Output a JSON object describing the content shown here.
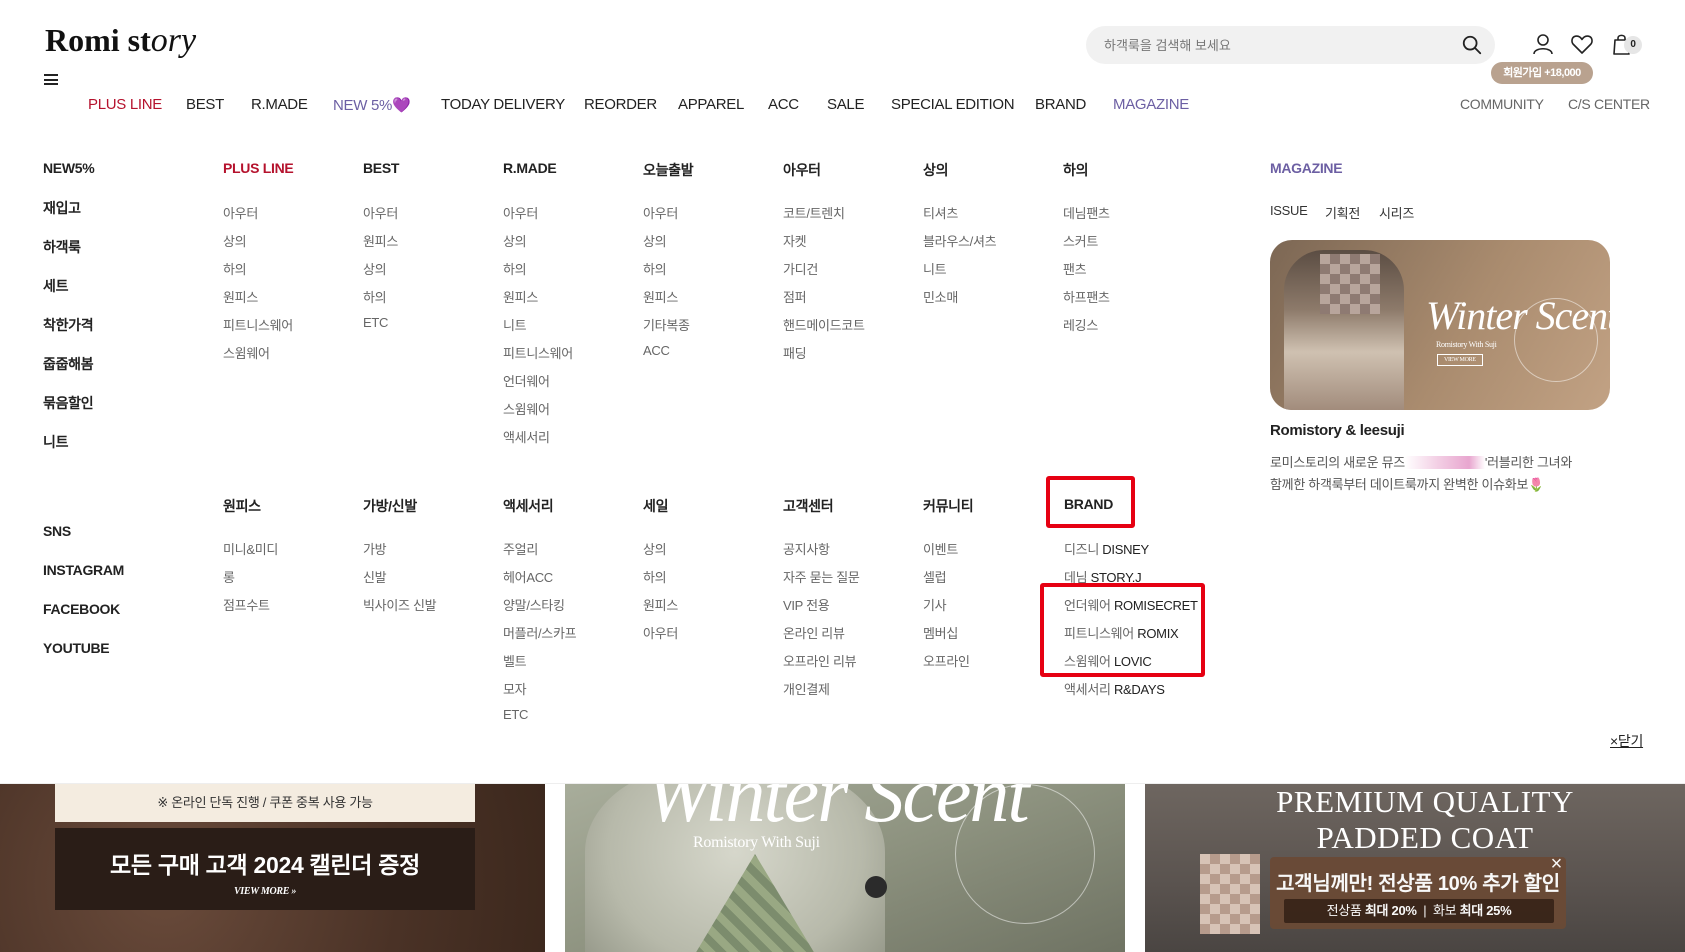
{
  "header": {
    "logo_main": "Romi st",
    "logo_script": "ory",
    "search_placeholder": "하객룩을 검색해 보세요",
    "cart_count": "0",
    "join_badge": "회원가입 +18,000"
  },
  "nav": {
    "items": [
      "PLUS LINE",
      "BEST",
      "R.MADE",
      "NEW 5%💜",
      "TODAY DELIVERY",
      "REORDER",
      "APPAREL",
      "ACC",
      "SALE",
      "SPECIAL EDITION",
      "BRAND",
      "MAGAZINE"
    ],
    "right": [
      "COMMUNITY",
      "C/S CENTER"
    ]
  },
  "left_menu": {
    "top": [
      "NEW5%",
      "재입고",
      "하객룩",
      "세트",
      "착한가격",
      "줍줍해봄",
      "묶음할인",
      "니트"
    ],
    "social": [
      "SNS",
      "INSTAGRAM",
      "FACEBOOK",
      "YOUTUBE"
    ]
  },
  "columns_row1": [
    {
      "head": "PLUS LINE",
      "items": [
        "아우터",
        "상의",
        "하의",
        "원피스",
        "피트니스웨어",
        "스윔웨어"
      ]
    },
    {
      "head": "BEST",
      "items": [
        "아우터",
        "원피스",
        "상의",
        "하의",
        "ETC"
      ]
    },
    {
      "head": "R.MADE",
      "items": [
        "아우터",
        "상의",
        "하의",
        "원피스",
        "니트",
        "피트니스웨어",
        "언더웨어",
        "스윔웨어",
        "액세서리"
      ]
    },
    {
      "head": "오늘출발",
      "items": [
        "아우터",
        "상의",
        "하의",
        "원피스",
        "기타복종",
        "ACC"
      ]
    },
    {
      "head": "아우터",
      "items": [
        "코트/트렌치",
        "자켓",
        "가디건",
        "점퍼",
        "핸드메이드코트",
        "패딩"
      ]
    },
    {
      "head": "상의",
      "items": [
        "티셔츠",
        "블라우스/셔츠",
        "니트",
        "민소매"
      ]
    },
    {
      "head": "하의",
      "items": [
        "데님팬츠",
        "스커트",
        "팬츠",
        "하프팬츠",
        "레깅스"
      ]
    }
  ],
  "columns_row2": [
    {
      "head": "원피스",
      "items": [
        "미니&미디",
        "롱",
        "점프수트"
      ]
    },
    {
      "head": "가방/신발",
      "items": [
        "가방",
        "신발",
        "빅사이즈 신발"
      ]
    },
    {
      "head": "액세서리",
      "items": [
        "주얼리",
        "헤어ACC",
        "양말/스타킹",
        "머플러/스카프",
        "벨트",
        "모자",
        "ETC"
      ]
    },
    {
      "head": "세일",
      "items": [
        "상의",
        "하의",
        "원피스",
        "아우터"
      ]
    },
    {
      "head": "고객센터",
      "items": [
        "공지사항",
        "자주 묻는 질문",
        "VIP 전용",
        "온라인 리뷰",
        "오프라인 리뷰",
        "개인결제"
      ]
    },
    {
      "head": "커뮤니티",
      "items": [
        "이벤트",
        "셀럽",
        "기사",
        "멤버십",
        "오프라인"
      ]
    }
  ],
  "brand": {
    "head": "BRAND",
    "items": [
      {
        "ko": "디즈니",
        "en": "DISNEY"
      },
      {
        "ko": "데님",
        "en": "STORY.J"
      },
      {
        "ko": "언더웨어",
        "en": "ROMISECRET"
      },
      {
        "ko": "피트니스웨어",
        "en": "ROMIX"
      },
      {
        "ko": "스윔웨어",
        "en": "LOVIC"
      },
      {
        "ko": "액세서리",
        "en": "R&DAYS"
      }
    ]
  },
  "magazine": {
    "head": "MAGAZINE",
    "tags": [
      "ISSUE",
      "기획전",
      "시리즈"
    ],
    "banner_title": "Winter Scent",
    "banner_sub": "Romistory With Suji",
    "banner_btn": "VIEW MORE",
    "title": "Romistory & leesuji",
    "desc1_a": "로미스토리의 새로운 뮤즈",
    "desc1_b": "'러블리한 그녀와",
    "desc2": "함께한 하객룩부터 데이트룩까지 완벽한 이슈화보🌷"
  },
  "close_label": "×닫기",
  "banners": {
    "b1_note": "※ 온라인 단독 진행 / 쿠폰 중복 사용 가능",
    "b1_title": "모든 구매 고객 2024 캘린더 증정",
    "b1_more": "VIEW MORE »",
    "b2_title": "Winter Scent",
    "b2_sub": "Romistory With Suji",
    "b3_line1": "PREMIUM QUALITY",
    "b3_line2": "PADDED COAT"
  },
  "popup": {
    "title": "고객님께만! 전상품 10% 추가 할인",
    "sub_a": "전상품",
    "sub_a_bold": "최대 20%",
    "sub_b": "화보",
    "sub_b_bold": "최대 25%",
    "close": "×"
  }
}
